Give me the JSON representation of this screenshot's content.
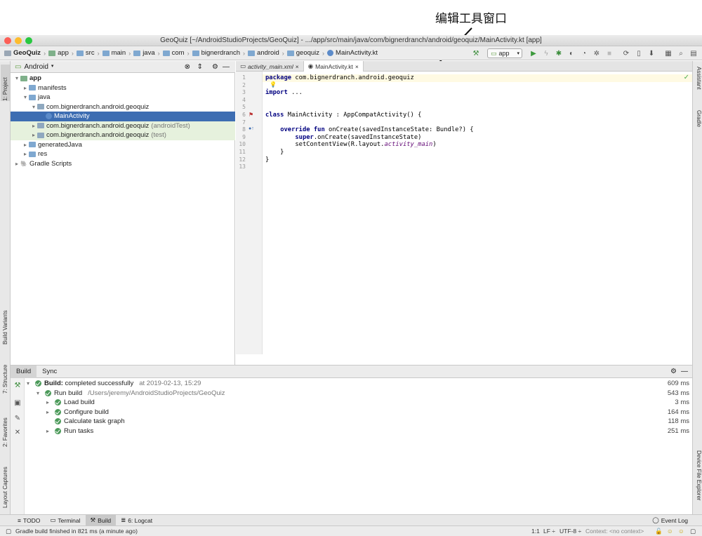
{
  "annotation": {
    "label": "编辑工具窗口"
  },
  "window": {
    "title": "GeoQuiz [~/AndroidStudioProjects/GeoQuiz] - .../app/src/main/java/com/bignerdranch/android/geoquiz/MainActivity.kt [app]"
  },
  "breadcrumbs": [
    "GeoQuiz",
    "app",
    "src",
    "main",
    "java",
    "com",
    "bignerdranch",
    "android",
    "geoquiz",
    "MainActivity.kt"
  ],
  "toolbar": {
    "run_config": "app"
  },
  "left_stripe": [
    "1: Project",
    "Build Variants",
    "7: Structure",
    "2: Favorites",
    "Layout Captures"
  ],
  "right_stripe": [
    "Assistant",
    "Gradle",
    "Device File Explorer"
  ],
  "project": {
    "view_mode": "Android",
    "tree": [
      {
        "label": "app",
        "depth": 0,
        "arrow": "▾",
        "bold": true,
        "icon": "module"
      },
      {
        "label": "manifests",
        "depth": 1,
        "arrow": "▸",
        "icon": "folder"
      },
      {
        "label": "java",
        "depth": 1,
        "arrow": "▾",
        "icon": "folder"
      },
      {
        "label": "com.bignerdranch.android.geoquiz",
        "depth": 2,
        "arrow": "▾",
        "icon": "package"
      },
      {
        "label": "MainActivity",
        "depth": 3,
        "arrow": "",
        "icon": "kotlin",
        "selected": true
      },
      {
        "label": "com.bignerdranch.android.geoquiz",
        "suffix": "(androidTest)",
        "depth": 2,
        "arrow": "▸",
        "icon": "package",
        "green": true
      },
      {
        "label": "com.bignerdranch.android.geoquiz",
        "suffix": "(test)",
        "depth": 2,
        "arrow": "▸",
        "icon": "package",
        "green": true
      },
      {
        "label": "generatedJava",
        "depth": 1,
        "arrow": "▸",
        "icon": "folder"
      },
      {
        "label": "res",
        "depth": 1,
        "arrow": "▸",
        "icon": "folder"
      },
      {
        "label": "Gradle Scripts",
        "depth": 0,
        "arrow": "▸",
        "icon": "gradle"
      }
    ]
  },
  "editor": {
    "tabs": [
      {
        "label": "activity_main.xml",
        "active": false
      },
      {
        "label": "MainActivity.kt",
        "active": true
      }
    ],
    "line_numbers": [
      "1",
      "2",
      "3",
      "4",
      "5",
      "6",
      "7",
      "8",
      "9",
      "10",
      "11",
      "12",
      "13"
    ],
    "code": [
      [
        {
          "t": "package ",
          "c": "kw"
        },
        {
          "t": "com.bignerdranch.android.geoquiz"
        }
      ],
      [],
      [
        {
          "t": "import ",
          "c": "kw"
        },
        {
          "t": "..."
        }
      ],
      [],
      [],
      [
        {
          "t": "class ",
          "c": "kw"
        },
        {
          "t": "MainActivity : AppCompatActivity() {"
        }
      ],
      [],
      [
        {
          "t": "    "
        },
        {
          "t": "override fun ",
          "c": "kw"
        },
        {
          "t": "onCreate(savedInstanceState: Bundle?) {"
        }
      ],
      [
        {
          "t": "        "
        },
        {
          "t": "super",
          "c": "kw"
        },
        {
          "t": ".onCreate(savedInstanceState)"
        }
      ],
      [
        {
          "t": "        setContentView(R.layout."
        },
        {
          "t": "activity_main",
          "c": "it"
        },
        {
          "t": ")"
        }
      ],
      [
        {
          "t": "    }"
        }
      ],
      [
        {
          "t": "}"
        }
      ],
      []
    ]
  },
  "build": {
    "tabs": [
      {
        "label": "Build",
        "active": true
      },
      {
        "label": "Sync",
        "active": false
      }
    ],
    "rows": [
      {
        "depth": 0,
        "arrow": "▾",
        "bold_label": "Build:",
        "label": " completed successfully",
        "extra": "at 2019-02-13, 15:29",
        "duration": "609 ms"
      },
      {
        "depth": 1,
        "arrow": "▾",
        "label": "Run build",
        "extra": "/Users/jeremy/AndroidStudioProjects/GeoQuiz",
        "duration": "543 ms"
      },
      {
        "depth": 2,
        "arrow": "▸",
        "label": "Load build",
        "duration": "3 ms"
      },
      {
        "depth": 2,
        "arrow": "▸",
        "label": "Configure build",
        "duration": "164 ms"
      },
      {
        "depth": 2,
        "arrow": "",
        "label": "Calculate task graph",
        "duration": "118 ms"
      },
      {
        "depth": 2,
        "arrow": "▸",
        "label": "Run tasks",
        "duration": "251 ms"
      }
    ]
  },
  "tool_windows": [
    {
      "label": "TODO",
      "icon": "≡",
      "active": false
    },
    {
      "label": "Terminal",
      "icon": "▭",
      "active": false
    },
    {
      "label": "Build",
      "icon": "⚒",
      "active": true
    },
    {
      "label": "6: Logcat",
      "icon": "≣",
      "active": false
    }
  ],
  "event_log": "Event Log",
  "status": {
    "message": "Gradle build finished in 821 ms (a minute ago)",
    "position": "1:1",
    "line_sep": "LF ÷",
    "encoding": "UTF-8 ÷",
    "context": "Context: <no context>"
  }
}
